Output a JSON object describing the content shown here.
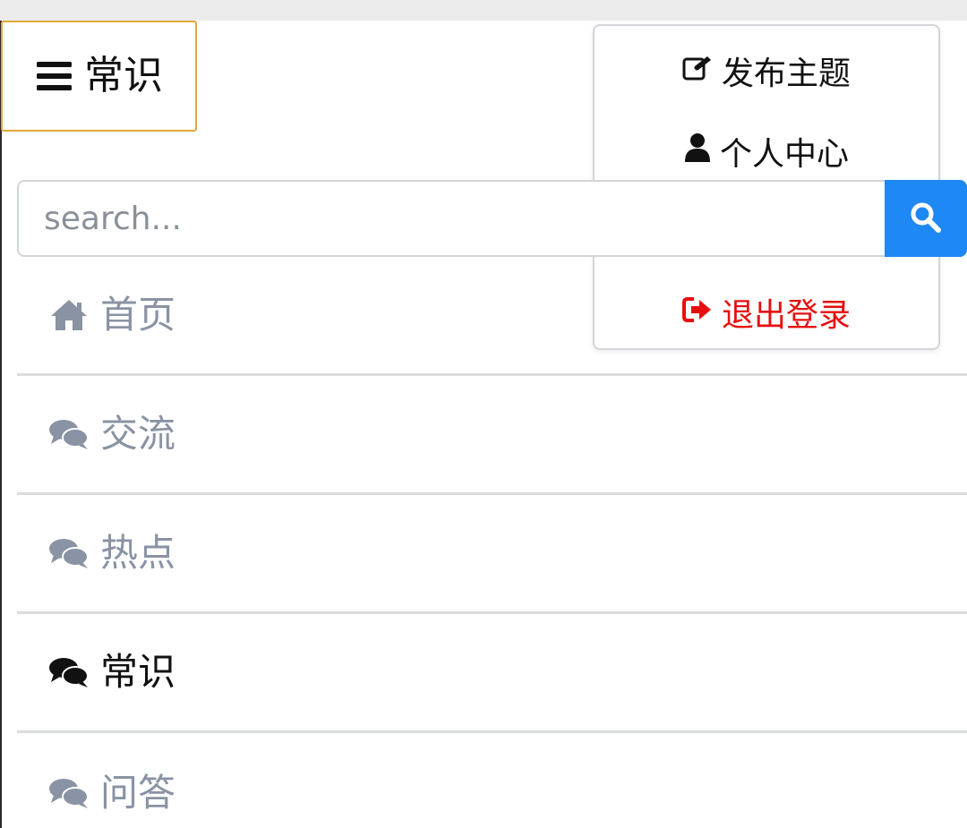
{
  "menu_toggle": {
    "label": "常识",
    "icon": "hamburger-icon"
  },
  "search": {
    "placeholder": "search...",
    "value": "",
    "button_icon": "search-icon"
  },
  "nav": {
    "items": [
      {
        "label": "首页",
        "icon": "home-icon",
        "active": false
      },
      {
        "label": "交流",
        "icon": "comments-icon",
        "active": false
      },
      {
        "label": "热点",
        "icon": "comments-icon",
        "active": false
      },
      {
        "label": "常识",
        "icon": "comments-icon",
        "active": true
      },
      {
        "label": "问答",
        "icon": "comments-icon",
        "active": false
      }
    ]
  },
  "dropdown": {
    "post_label": "发布主题",
    "post_icon": "edit-icon",
    "profile_label": "个人中心",
    "profile_icon": "user-icon",
    "logout_label": "退出登录",
    "logout_icon": "sign-out-icon"
  },
  "colors": {
    "accent": "#1e88f4",
    "toggle_border": "#e3a93b",
    "inactive_text": "#8a93a3",
    "active_text": "#111111",
    "logout": "#e60f0f"
  }
}
